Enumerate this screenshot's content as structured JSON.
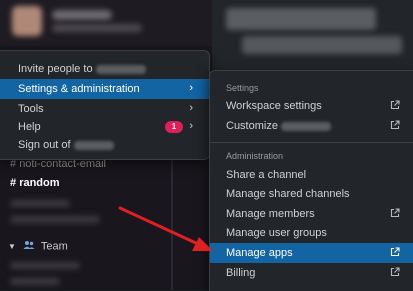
{
  "sidebar": {
    "channels": [
      {
        "prefix": "#",
        "label": "noti-contact-email",
        "bold": false
      },
      {
        "prefix": "#",
        "label": "random",
        "bold": true
      }
    ],
    "team_label": "Team"
  },
  "menu": {
    "items": [
      {
        "label": "Invite people to",
        "has_chevron": false,
        "active": false
      },
      {
        "label": "Settings & administration",
        "has_chevron": true,
        "active": true
      },
      {
        "label": "Tools",
        "has_chevron": true,
        "active": false
      },
      {
        "label": "Help",
        "has_chevron": true,
        "active": false,
        "badge": "1"
      },
      {
        "label": "Sign out of",
        "has_chevron": false,
        "active": false
      }
    ]
  },
  "submenu": {
    "settings_header": "Settings",
    "settings_items": [
      {
        "label": "Workspace settings",
        "external": true
      },
      {
        "label": "Customize",
        "external": true
      }
    ],
    "admin_header": "Administration",
    "admin_items": [
      {
        "label": "Share a channel",
        "external": false
      },
      {
        "label": "Manage shared channels",
        "external": false
      },
      {
        "label": "Manage members",
        "external": true
      },
      {
        "label": "Manage user groups",
        "external": false
      },
      {
        "label": "Manage apps",
        "external": true,
        "active": true
      },
      {
        "label": "Billing",
        "external": true
      }
    ]
  },
  "icons": {
    "chevron": "chevron-right-icon",
    "external": "external-link-icon",
    "team": "people-icon",
    "caret": "caret-down-icon",
    "annotation": "red-arrow"
  },
  "colors": {
    "highlight": "#1264a3",
    "badge": "#e01e5a",
    "arrow": "#e02020",
    "menu_bg": "#222529"
  }
}
